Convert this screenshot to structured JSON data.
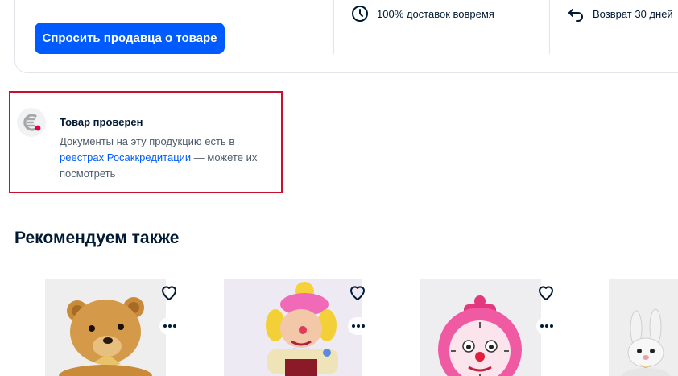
{
  "seller": {
    "ask_button": "Спросить продавца о товаре",
    "features": [
      {
        "icon": "clock-icon",
        "label": "100% доставок вовремя"
      },
      {
        "icon": "return-arrow-icon",
        "label": "Возврат 30 дней"
      }
    ]
  },
  "verified": {
    "logo": "rosakkreditatsiya-logo-icon",
    "title": "Товар проверен",
    "text_before": "Документы на эту продукцию есть в ",
    "link": "реестрах Росаккредитации",
    "text_after": " — можете их посмотреть"
  },
  "recommend": {
    "title": "Рекомендуем также",
    "products": [
      {
        "image": "teddy-bear-toy",
        "favorite_icon": "heart-icon",
        "more_icon": "more-dots-icon"
      },
      {
        "image": "clown-toy",
        "favorite_icon": "heart-icon",
        "more_icon": "more-dots-icon"
      },
      {
        "image": "pink-clock-toy",
        "favorite_icon": "heart-icon",
        "more_icon": "more-dots-icon"
      },
      {
        "image": "bunny-toy"
      }
    ]
  },
  "colors": {
    "accent": "#005bff",
    "text": "#001a34",
    "secondary_text": "#4d5b6b",
    "highlight_border": "#c8102e"
  }
}
